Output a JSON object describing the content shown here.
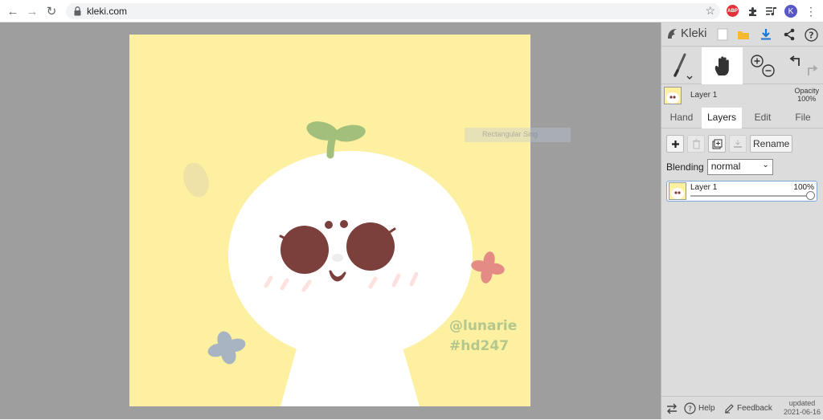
{
  "browser": {
    "url": "kleki.com",
    "avatar_letter": "K",
    "abp_label": "ABP"
  },
  "canvas": {
    "watermark_handle": "@lunarie",
    "watermark_tag": "#hd247",
    "ghost_tooltip": "Rectangular Sing"
  },
  "sidebar": {
    "app_name": "Kleki",
    "layer_preview_name": "Layer 1",
    "opacity_label": "Opacity",
    "opacity_value": "100%",
    "tabs": [
      "Hand",
      "Layers",
      "Edit",
      "File"
    ],
    "active_tab": "Layers",
    "rename_label": "Rename",
    "blending_label": "Blending",
    "blending_value": "normal",
    "layers": [
      {
        "name": "Layer 1",
        "opacity": "100%"
      }
    ],
    "bottom": {
      "help": "Help",
      "feedback": "Feedback",
      "updated_label": "updated",
      "updated_date": "2021-06-16"
    }
  },
  "colors": {
    "canvas_bg": "#fdf0a0",
    "workspace": "#9e9e9e",
    "sidebar": "#dcdcdc",
    "eye": "#7b3f3c",
    "sprout": "#a3bf7c",
    "watermark": "#b4c78c"
  }
}
